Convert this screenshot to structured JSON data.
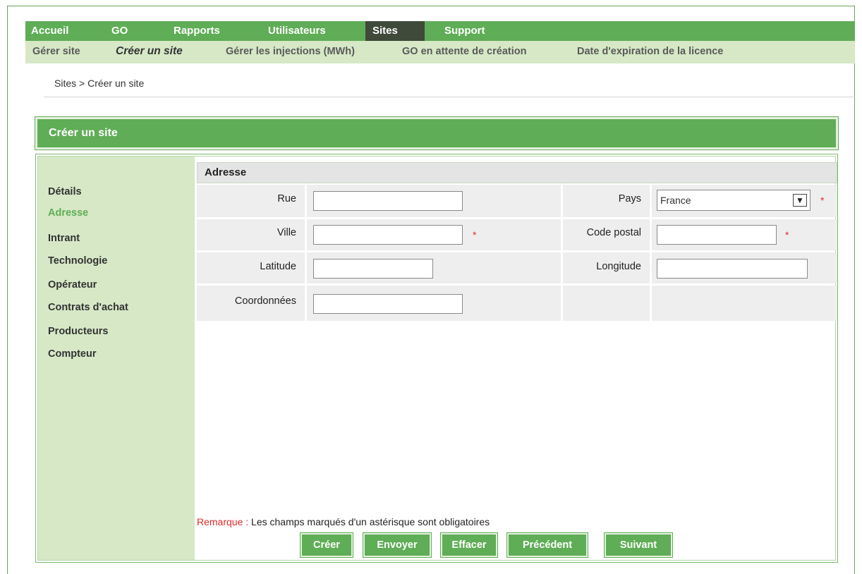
{
  "topnav": {
    "items": [
      "Accueil",
      "GO",
      "Rapports",
      "Utilisateurs",
      "Sites",
      "Support"
    ],
    "active": "Sites"
  },
  "subnav": {
    "items": [
      "Gérer site",
      "Créer un site",
      "Gérer les injections (MWh)",
      "GO en attente de création",
      "Date d'expiration de la licence"
    ],
    "current": "Créer un site"
  },
  "breadcrumb": "Sites > Créer un site",
  "panel_title": "Créer un site",
  "sidebar": {
    "items": [
      "Détails",
      "Adresse",
      "Intrant",
      "Technologie",
      "Opérateur",
      "Contrats d'achat",
      "Producteurs",
      "Compteur"
    ],
    "active": "Adresse"
  },
  "section": {
    "title": "Adresse"
  },
  "form": {
    "rue": {
      "label": "Rue",
      "value": ""
    },
    "ville": {
      "label": "Ville",
      "value": ""
    },
    "latitude": {
      "label": "Latitude",
      "value": ""
    },
    "coordonnees": {
      "label": "Coordonnées",
      "value": ""
    },
    "pays": {
      "label": "Pays",
      "value": "France"
    },
    "code_postal": {
      "label": "Code postal",
      "value": ""
    },
    "longitude": {
      "label": "Longitude",
      "value": ""
    },
    "required_mark": "*"
  },
  "remark": {
    "label": "Remarque :",
    "text": " Les champs marqués d'un astérisque sont obligatoires"
  },
  "buttons": {
    "creer": "Créer",
    "envoyer": "Envoyer",
    "effacer": "Effacer",
    "precedent": "Précédent",
    "suivant": "Suivant"
  },
  "colors": {
    "brand_green": "#5fad56",
    "light_green": "#d6e8c6",
    "required_red": "#e02b2b"
  }
}
